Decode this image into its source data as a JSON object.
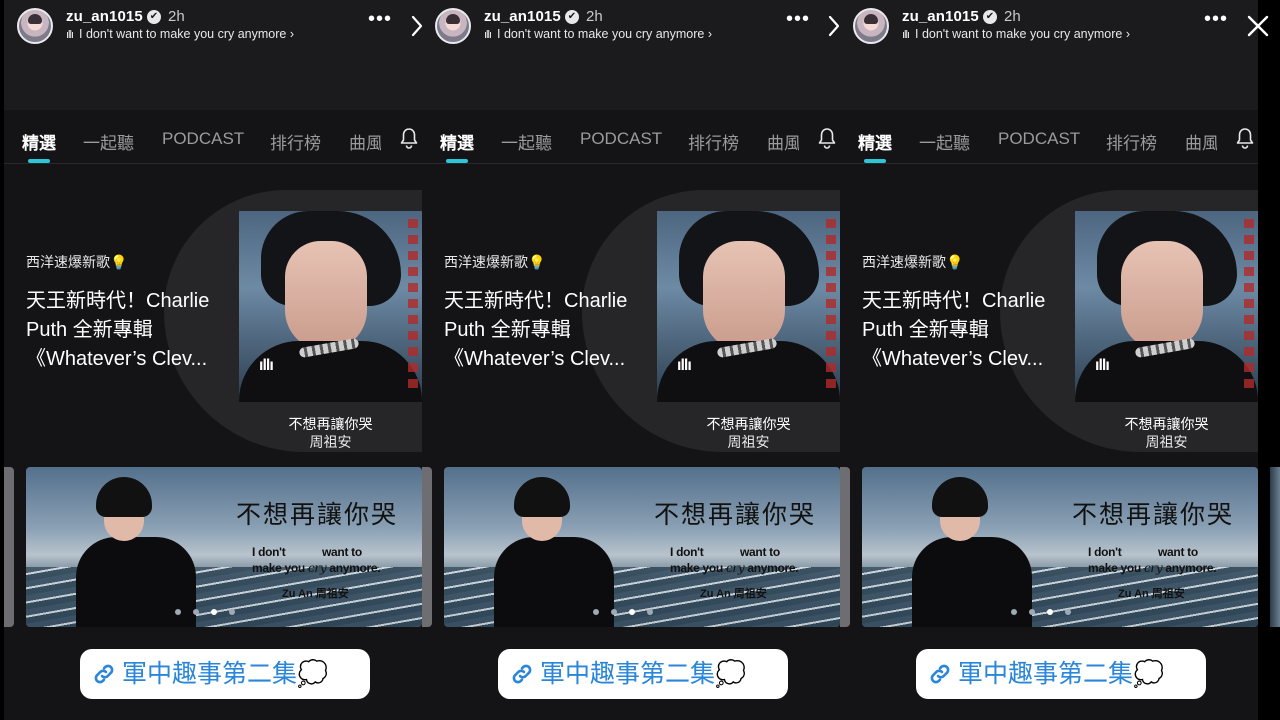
{
  "story": {
    "username": "zu_an1015",
    "verified_mark": "✔",
    "time": "2h",
    "music": "I don't want to make you cry anymore",
    "music_arrow": "›",
    "more": "•••"
  },
  "app": {
    "tabs": [
      "精選",
      "一起聽",
      "PODCAST",
      "排行榜",
      "曲風"
    ],
    "active_tab": 0,
    "accent_color": "#2dc5d9"
  },
  "feature": {
    "small_label": "西洋速爆新歌💡",
    "title": "天王新時代！Charlie Puth 全新專輯《Whatever’s Clev...",
    "track_title": "不想再讓你哭",
    "track_artist": "周祖安",
    "eq_icon": "ıllı"
  },
  "banner": {
    "cjk_title": "不想再讓你哭",
    "en_line1_left": "I don't",
    "en_line1_right": "want to",
    "en_line2_a": "make you ",
    "en_line2_b": "cry",
    "en_line2_c": " anymore.",
    "artist": "Zu An  周祖安",
    "dots_total": 4,
    "dots_active": 2
  },
  "sticker": {
    "text": "軍中趣事第二集💭",
    "color": "#2a86d8"
  },
  "icons": [
    "more-dots-icon",
    "chevron-right-icon",
    "close-icon",
    "bell-icon",
    "link-icon",
    "verified-icon",
    "sound-bars-icon"
  ]
}
